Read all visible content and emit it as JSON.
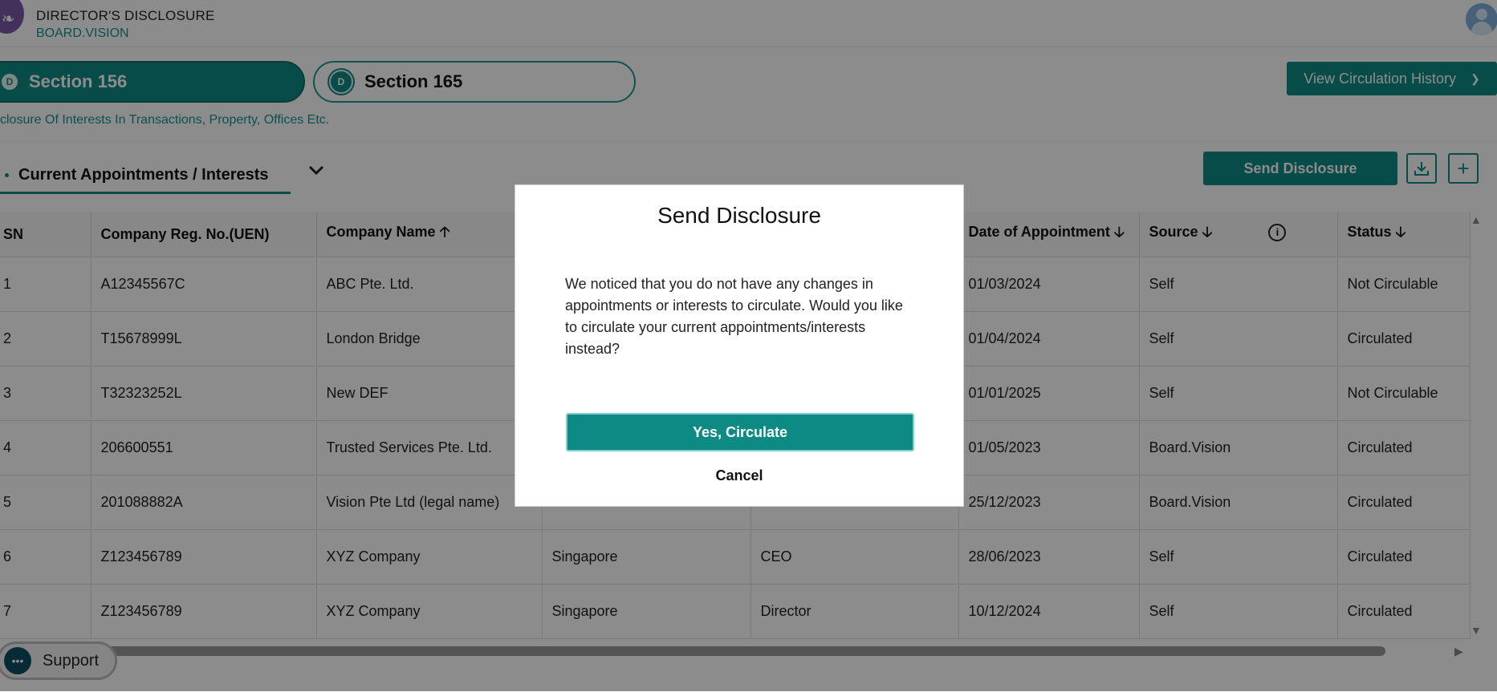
{
  "header": {
    "title": "DIRECTOR'S DISCLOSURE",
    "subtitle": "BOARD.VISION"
  },
  "sections": [
    {
      "badge": "D",
      "label": "Section 156"
    },
    {
      "badge": "D",
      "label": "Section 165"
    }
  ],
  "section_description": "closure Of Interests In Transactions, Property, Offices Etc.",
  "history_button": "View Circulation History",
  "tab": {
    "label": "Current Appointments / Interests"
  },
  "toolbar": {
    "send_label": "Send Disclosure"
  },
  "table": {
    "headers": {
      "sn": "SN",
      "uen": "Company Reg. No.(UEN)",
      "name": "Company Name",
      "date": "Date of Appointment",
      "source": "Source",
      "status": "Status"
    },
    "rows": [
      {
        "sn": "1",
        "uen": "A12345567C",
        "name": "ABC Pte. Ltd.",
        "country": "",
        "role": "",
        "date": "01/03/2024",
        "source": "Self",
        "status": "Not Circulable"
      },
      {
        "sn": "2",
        "uen": "T15678999L",
        "name": "London Bridge",
        "country": "",
        "role": "",
        "date": "01/04/2024",
        "source": "Self",
        "status": "Circulated"
      },
      {
        "sn": "3",
        "uen": "T32323252L",
        "name": "New DEF",
        "country": "",
        "role": "",
        "date": "01/01/2025",
        "source": "Self",
        "status": "Not Circulable"
      },
      {
        "sn": "4",
        "uen": "206600551",
        "name": "Trusted Services Pte. Ltd.",
        "country": "",
        "role": "",
        "date": "01/05/2023",
        "source": "Board.Vision",
        "status": "Circulated"
      },
      {
        "sn": "5",
        "uen": "201088882A",
        "name": "Vision Pte Ltd (legal name)",
        "country": "",
        "role": "",
        "date": "25/12/2023",
        "source": "Board.Vision",
        "status": "Circulated"
      },
      {
        "sn": "6",
        "uen": "Z123456789",
        "name": "XYZ Company",
        "country": "Singapore",
        "role": "CEO",
        "date": "28/06/2023",
        "source": "Self",
        "status": "Circulated"
      },
      {
        "sn": "7",
        "uen": "Z123456789",
        "name": "XYZ Company",
        "country": "Singapore",
        "role": "Director",
        "date": "10/12/2024",
        "source": "Self",
        "status": "Circulated"
      }
    ]
  },
  "support": {
    "label": "Support"
  },
  "modal": {
    "title": "Send Disclosure",
    "message": "We noticed that you do not have any changes in appointments or interests to circulate. Would you like to circulate your current appointments/interests instead?",
    "confirm_label": "Yes, Circulate",
    "cancel_label": "Cancel"
  },
  "icons": {
    "logo": "logo-icon",
    "avatar": "user-avatar-icon",
    "chevron": "chevron-down-icon",
    "download": "download-icon",
    "add": "plus-icon",
    "info": "info-icon",
    "support": "chat-icon"
  },
  "colors": {
    "primary": "#0e8a84",
    "accent_text": "#12968f"
  }
}
